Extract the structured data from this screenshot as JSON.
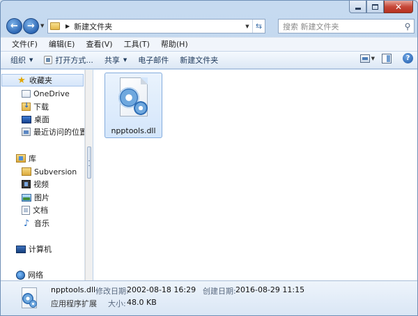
{
  "address": {
    "path": "新建文件夹",
    "search_placeholder": "搜索 新建文件夹"
  },
  "menu": [
    "文件(F)",
    "编辑(E)",
    "查看(V)",
    "工具(T)",
    "帮助(H)"
  ],
  "commands": {
    "organize": "组织",
    "open_with": "打开方式...",
    "share": "共享",
    "email": "电子邮件",
    "new_folder": "新建文件夹"
  },
  "nav": {
    "favorites": "收藏夹",
    "onedrive": "OneDrive",
    "downloads": "下载",
    "desktop": "桌面",
    "recent": "最近访问的位置",
    "libraries": "库",
    "subversion": "Subversion",
    "videos": "视频",
    "pictures": "图片",
    "documents": "文档",
    "music": "音乐",
    "computer": "计算机",
    "network": "网络"
  },
  "file": {
    "name": "npptools.dll"
  },
  "details": {
    "name": "npptools.dll",
    "type": "应用程序扩展",
    "modified_label": "修改日期:",
    "modified_value": "2002-08-18 16:29",
    "size_label": "大小:",
    "size_value": "48.0 KB",
    "created_label": "创建日期:",
    "created_value": "2016-08-29 11:15"
  }
}
